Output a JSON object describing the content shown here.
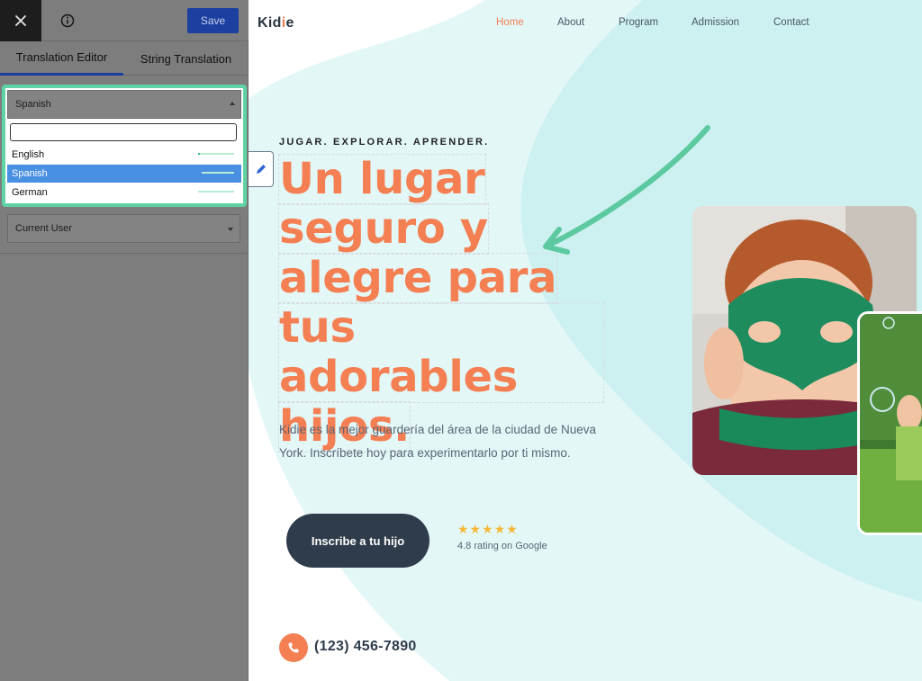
{
  "panel": {
    "save_label": "Save",
    "tabs": [
      {
        "label": "Translation Editor",
        "active": true
      },
      {
        "label": "String Translation",
        "active": false
      }
    ],
    "language_select": {
      "selected": "Spanish",
      "search_value": "",
      "options": [
        {
          "label": "English",
          "progress": 0.05
        },
        {
          "label": "Spanish",
          "progress": 0.9,
          "highlighted": true
        },
        {
          "label": "German",
          "progress": 0.0
        }
      ]
    },
    "user_select": {
      "selected": "Current User"
    }
  },
  "site": {
    "logo": {
      "prefix": "Kid",
      "dot": "i",
      "suffix": "e"
    },
    "nav": [
      "Home",
      "About",
      "Program",
      "Admission",
      "Contact"
    ],
    "active_nav": "Home",
    "eyebrow": "JUGAR. EXPLORAR. APRENDER.",
    "headline_lines": [
      "Un lugar",
      "seguro y",
      "alegre para",
      "tus adorables",
      "hijos."
    ],
    "subtext": "Kidie es la mejor guardería del área de la ciudad de Nueva York. Inscríbete hoy para experimentarlo por ti mismo.",
    "enroll_button": "Inscribe a tu hijo",
    "stars": "★★★★★",
    "rating": "4.8 rating on Google",
    "phone": "(123) 456-7890"
  },
  "colors": {
    "accent": "#f47f53",
    "dark": "#2f3c4b",
    "panel_highlight": "#5fd3a4",
    "save_blue": "#1c3fa0",
    "option_selected": "#4a90e2",
    "blob_light": "#e3f7f7",
    "blob_mid": "#cdf1f0",
    "arrow": "#5cc9a0"
  },
  "icons": {
    "close": "close-icon",
    "info": "info-icon",
    "edit": "pencil-icon",
    "phone": "phone-icon"
  }
}
